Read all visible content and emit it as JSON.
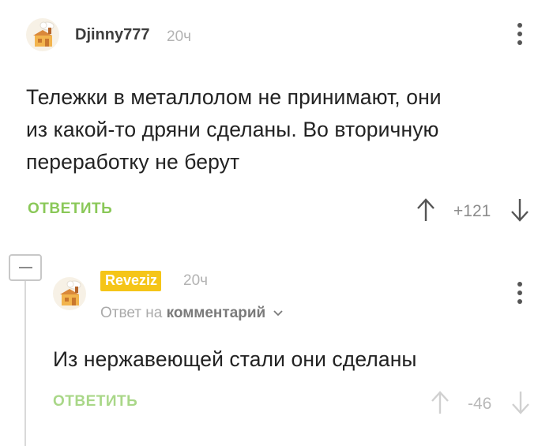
{
  "comments": [
    {
      "username": "Djinny777",
      "time": "20ч",
      "text_lines": [
        "Тележки в металлолом не принимают, они",
        "из какой-то дряни сделаны. Во вторичную",
        "переработку не берут"
      ],
      "reply_label": "ОТВЕТИТЬ",
      "rating": "+121",
      "icons": {
        "avatar": "avatar-icon",
        "menu": "more-vertical-icon",
        "up": "arrow-up-icon",
        "down": "arrow-down-icon"
      }
    },
    {
      "username": "Reveziz",
      "time": "20ч",
      "reply_to_prefix": "Ответ на",
      "reply_to_target": "комментарий",
      "text_lines": [
        "Из нержавеющей стали они сделаны"
      ],
      "reply_label": "ОТВЕТИТЬ",
      "rating": "-46",
      "icons": {
        "avatar": "avatar-icon",
        "menu": "more-vertical-icon",
        "up": "arrow-up-icon",
        "down": "arrow-down-icon",
        "collapse": "collapse-minus-icon",
        "reply_chevron": "chevron-down-icon"
      }
    }
  ],
  "colors": {
    "accent_green": "#8ac858",
    "accent_green_faded": "#a9d788",
    "author_badge_yellow": "#f5c518",
    "muted_text": "#b3b3b3"
  }
}
